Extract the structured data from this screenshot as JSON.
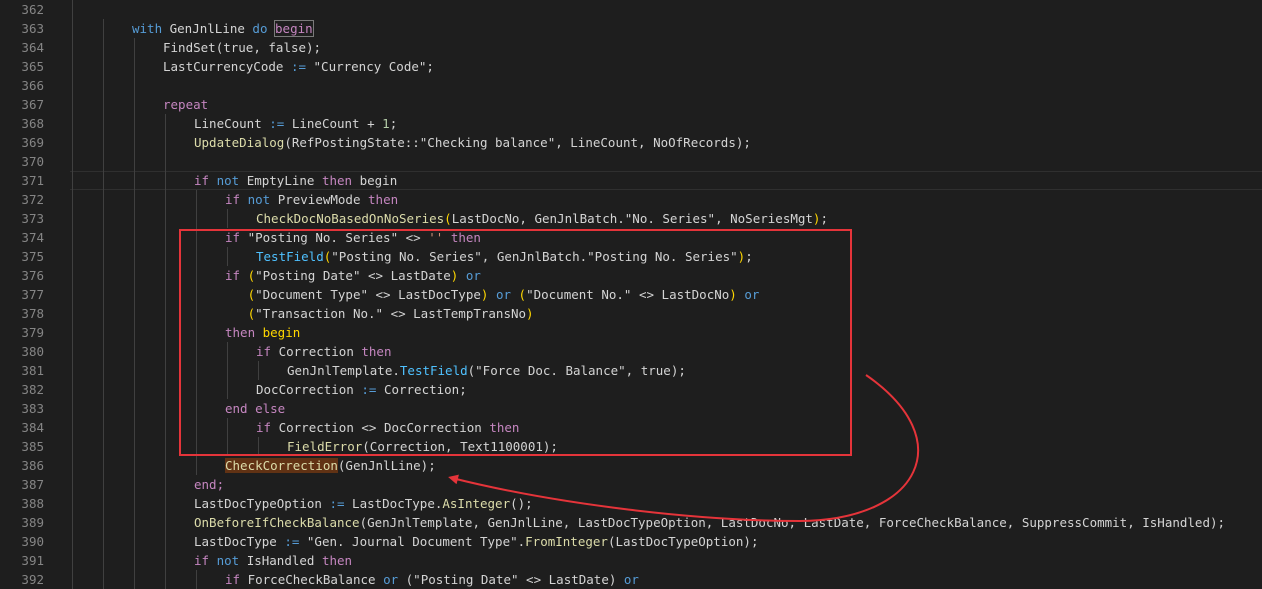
{
  "editor": {
    "highlight_color": "#e5343a",
    "lines": [
      {
        "num": "362",
        "indent": 0,
        "tokens": []
      },
      {
        "num": "363",
        "indent": 2,
        "tokens": [
          {
            "t": "with",
            "c": "kw"
          },
          {
            "t": " GenJnlLine ",
            "c": "plain"
          },
          {
            "t": "do",
            "c": "kw"
          },
          {
            "t": " ",
            "c": "plain"
          },
          {
            "t": "begin",
            "c": "ctrl",
            "m": "match"
          }
        ]
      },
      {
        "num": "364",
        "indent": 3,
        "tokens": [
          {
            "t": "FindSet",
            "c": "plain"
          },
          {
            "t": "(",
            "c": "plain"
          },
          {
            "t": "true",
            "c": "plain"
          },
          {
            "t": ", ",
            "c": "plain"
          },
          {
            "t": "false",
            "c": "plain"
          },
          {
            "t": ");",
            "c": "plain"
          }
        ]
      },
      {
        "num": "365",
        "indent": 3,
        "tokens": [
          {
            "t": "LastCurrencyCode ",
            "c": "plain"
          },
          {
            "t": ":=",
            "c": "kw"
          },
          {
            "t": " \"Currency Code\";",
            "c": "plain"
          }
        ]
      },
      {
        "num": "366",
        "indent": 0,
        "tokens": []
      },
      {
        "num": "367",
        "indent": 3,
        "tokens": [
          {
            "t": "repeat",
            "c": "ctrl"
          }
        ]
      },
      {
        "num": "368",
        "indent": 4,
        "tokens": [
          {
            "t": "LineCount ",
            "c": "plain"
          },
          {
            "t": ":=",
            "c": "kw"
          },
          {
            "t": " LineCount + ",
            "c": "plain"
          },
          {
            "t": "1",
            "c": "num"
          },
          {
            "t": ";",
            "c": "plain"
          }
        ]
      },
      {
        "num": "369",
        "indent": 4,
        "tokens": [
          {
            "t": "UpdateDialog",
            "c": "fn"
          },
          {
            "t": "(RefPostingState::\"Checking balance\", LineCount, NoOfRecords);",
            "c": "plain"
          }
        ]
      },
      {
        "num": "370",
        "indent": 0,
        "tokens": []
      },
      {
        "num": "371",
        "indent": 4,
        "current": true,
        "tokens": [
          {
            "t": "if",
            "c": "ctrl"
          },
          {
            "t": " ",
            "c": "plain"
          },
          {
            "t": "not",
            "c": "kw"
          },
          {
            "t": " EmptyLine ",
            "c": "plain"
          },
          {
            "t": "then",
            "c": "ctrl"
          },
          {
            "t": " begin",
            "c": "plain"
          }
        ]
      },
      {
        "num": "372",
        "indent": 5,
        "tokens": [
          {
            "t": "if",
            "c": "ctrl"
          },
          {
            "t": " ",
            "c": "plain"
          },
          {
            "t": "not",
            "c": "kw"
          },
          {
            "t": " PreviewMode ",
            "c": "plain"
          },
          {
            "t": "then",
            "c": "ctrl"
          }
        ]
      },
      {
        "num": "373",
        "indent": 6,
        "tokens": [
          {
            "t": "CheckDocNoBasedOnNoSeries",
            "c": "fn"
          },
          {
            "t": "(",
            "c": "par"
          },
          {
            "t": "LastDocNo, GenJnlBatch.\"No. Series\", NoSeriesMgt",
            "c": "plain"
          },
          {
            "t": ")",
            "c": "par"
          },
          {
            "t": ";",
            "c": "plain"
          }
        ]
      },
      {
        "num": "374",
        "indent": 5,
        "tokens": [
          {
            "t": "if",
            "c": "ctrl"
          },
          {
            "t": " \"Posting No. Series\" <> ",
            "c": "plain"
          },
          {
            "t": "''",
            "c": "str"
          },
          {
            "t": " ",
            "c": "plain"
          },
          {
            "t": "then",
            "c": "ctrl"
          }
        ]
      },
      {
        "num": "375",
        "indent": 6,
        "tokens": [
          {
            "t": "TestField",
            "c": "meth"
          },
          {
            "t": "(",
            "c": "par"
          },
          {
            "t": "\"Posting No. Series\", GenJnlBatch.\"Posting No. Series\"",
            "c": "plain"
          },
          {
            "t": ")",
            "c": "par"
          },
          {
            "t": ";",
            "c": "plain"
          }
        ]
      },
      {
        "num": "376",
        "indent": 5,
        "tokens": [
          {
            "t": "if",
            "c": "ctrl"
          },
          {
            "t": " ",
            "c": "plain"
          },
          {
            "t": "(",
            "c": "par"
          },
          {
            "t": "\"Posting Date\" <> LastDate",
            "c": "plain"
          },
          {
            "t": ")",
            "c": "par"
          },
          {
            "t": " ",
            "c": "plain"
          },
          {
            "t": "or",
            "c": "kw"
          }
        ]
      },
      {
        "num": "377",
        "indent": 5,
        "extra": "   ",
        "tokens": [
          {
            "t": "(",
            "c": "par"
          },
          {
            "t": "\"Document Type\" <> LastDocType",
            "c": "plain"
          },
          {
            "t": ")",
            "c": "par"
          },
          {
            "t": " ",
            "c": "plain"
          },
          {
            "t": "or",
            "c": "kw"
          },
          {
            "t": " ",
            "c": "plain"
          },
          {
            "t": "(",
            "c": "par"
          },
          {
            "t": "\"Document No.\" <> LastDocNo",
            "c": "plain"
          },
          {
            "t": ")",
            "c": "par"
          },
          {
            "t": " ",
            "c": "plain"
          },
          {
            "t": "or",
            "c": "kw"
          }
        ]
      },
      {
        "num": "378",
        "indent": 5,
        "extra": "   ",
        "tokens": [
          {
            "t": "(",
            "c": "par"
          },
          {
            "t": "\"Transaction No.\" <> LastTempTransNo",
            "c": "plain"
          },
          {
            "t": ")",
            "c": "par"
          }
        ]
      },
      {
        "num": "379",
        "indent": 5,
        "tokens": [
          {
            "t": "then",
            "c": "ctrl"
          },
          {
            "t": " begin",
            "c": "par"
          }
        ]
      },
      {
        "num": "380",
        "indent": 6,
        "tokens": [
          {
            "t": "if",
            "c": "ctrl"
          },
          {
            "t": " Correction ",
            "c": "plain"
          },
          {
            "t": "then",
            "c": "ctrl"
          }
        ]
      },
      {
        "num": "381",
        "indent": 7,
        "tokens": [
          {
            "t": "GenJnlTemplate.",
            "c": "plain"
          },
          {
            "t": "TestField",
            "c": "meth"
          },
          {
            "t": "(\"Force Doc. Balance\", ",
            "c": "plain"
          },
          {
            "t": "true",
            "c": "plain"
          },
          {
            "t": ");",
            "c": "plain"
          }
        ]
      },
      {
        "num": "382",
        "indent": 6,
        "tokens": [
          {
            "t": "DocCorrection ",
            "c": "plain"
          },
          {
            "t": ":=",
            "c": "kw"
          },
          {
            "t": " Correction;",
            "c": "plain"
          }
        ]
      },
      {
        "num": "383",
        "indent": 5,
        "tokens": [
          {
            "t": "end",
            "c": "ctrl"
          },
          {
            "t": " ",
            "c": "plain"
          },
          {
            "t": "else",
            "c": "ctrl"
          }
        ]
      },
      {
        "num": "384",
        "indent": 6,
        "tokens": [
          {
            "t": "if",
            "c": "ctrl"
          },
          {
            "t": " Correction <> DocCorrection ",
            "c": "plain"
          },
          {
            "t": "then",
            "c": "ctrl"
          }
        ]
      },
      {
        "num": "385",
        "indent": 7,
        "tokens": [
          {
            "t": "FieldError",
            "c": "fn"
          },
          {
            "t": "(Correction, Text1100001);",
            "c": "plain"
          }
        ]
      },
      {
        "num": "386",
        "indent": 5,
        "tokens": [
          {
            "t": "CheckCorrection",
            "c": "fn",
            "m": "sel"
          },
          {
            "t": "(GenJnlLine);",
            "c": "plain"
          }
        ]
      },
      {
        "num": "387",
        "indent": 4,
        "tokens": [
          {
            "t": "end;",
            "c": "ctrl"
          }
        ]
      },
      {
        "num": "388",
        "indent": 4,
        "tokens": [
          {
            "t": "LastDocTypeOption ",
            "c": "plain"
          },
          {
            "t": ":=",
            "c": "kw"
          },
          {
            "t": " LastDocType.",
            "c": "plain"
          },
          {
            "t": "AsInteger",
            "c": "fn"
          },
          {
            "t": "();",
            "c": "plain"
          }
        ]
      },
      {
        "num": "389",
        "indent": 4,
        "tokens": [
          {
            "t": "OnBeforeIfCheckBalance",
            "c": "fn"
          },
          {
            "t": "(GenJnlTemplate, GenJnlLine, LastDocTypeOption, LastDocNo, LastDate, ForceCheckBalance, SuppressCommit, IsHandled);",
            "c": "plain"
          }
        ]
      },
      {
        "num": "390",
        "indent": 4,
        "tokens": [
          {
            "t": "LastDocType ",
            "c": "plain"
          },
          {
            "t": ":=",
            "c": "kw"
          },
          {
            "t": " \"Gen. Journal Document Type\".",
            "c": "plain"
          },
          {
            "t": "FromInteger",
            "c": "fn"
          },
          {
            "t": "(LastDocTypeOption);",
            "c": "plain"
          }
        ]
      },
      {
        "num": "391",
        "indent": 4,
        "tokens": [
          {
            "t": "if",
            "c": "ctrl"
          },
          {
            "t": " ",
            "c": "plain"
          },
          {
            "t": "not",
            "c": "kw"
          },
          {
            "t": " IsHandled ",
            "c": "plain"
          },
          {
            "t": "then",
            "c": "ctrl"
          }
        ]
      },
      {
        "num": "392",
        "indent": 5,
        "tokens": [
          {
            "t": "if",
            "c": "ctrl"
          },
          {
            "t": " ForceCheckBalance ",
            "c": "plain"
          },
          {
            "t": "or",
            "c": "kw"
          },
          {
            "t": " (\"Posting Date\" <> LastDate) ",
            "c": "plain"
          },
          {
            "t": "or",
            "c": "kw"
          }
        ]
      }
    ]
  }
}
